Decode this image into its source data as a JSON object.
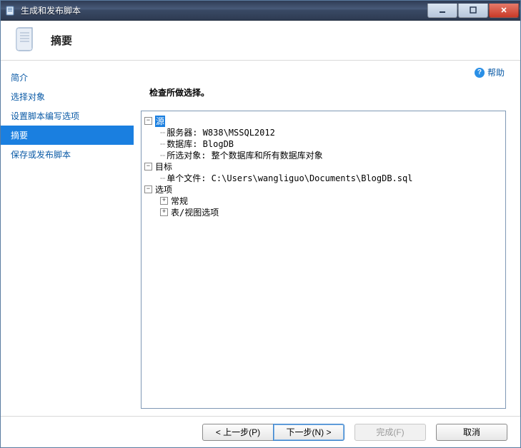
{
  "window": {
    "title": "生成和发布脚本"
  },
  "header": {
    "page_title": "摘要"
  },
  "sidebar": {
    "items": [
      {
        "label": "简介",
        "selected": false
      },
      {
        "label": "选择对象",
        "selected": false
      },
      {
        "label": "设置脚本编写选项",
        "selected": false
      },
      {
        "label": "摘要",
        "selected": true
      },
      {
        "label": "保存或发布脚本",
        "selected": false
      }
    ]
  },
  "content": {
    "help_label": "帮助",
    "instruction": "检查所做选择。",
    "tree": {
      "source": {
        "label": "源",
        "server": "服务器: W838\\MSSQL2012",
        "database": "数据库: BlogDB",
        "objects": "所选对象: 整个数据库和所有数据库对象"
      },
      "target": {
        "label": "目标",
        "file": "单个文件: C:\\Users\\wangliguo\\Documents\\BlogDB.sql"
      },
      "options": {
        "label": "选项",
        "general": "常规",
        "tableview": "表/视图选项"
      }
    }
  },
  "footer": {
    "prev": "< 上一步(P)",
    "next": "下一步(N) >",
    "finish": "完成(F)",
    "cancel": "取消"
  }
}
